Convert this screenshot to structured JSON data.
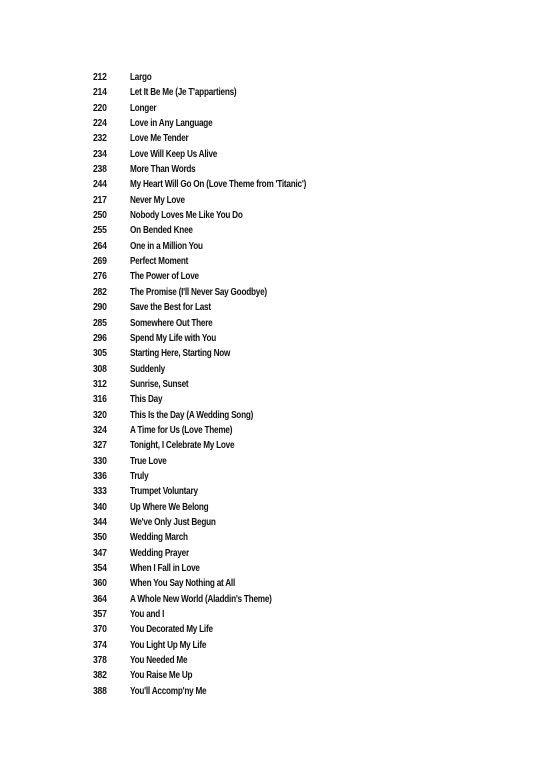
{
  "contents": [
    {
      "page": "212",
      "title": "Largo"
    },
    {
      "page": "214",
      "title": "Let It Be Me (Je T'appartiens)"
    },
    {
      "page": "220",
      "title": "Longer"
    },
    {
      "page": "224",
      "title": "Love in Any Language"
    },
    {
      "page": "232",
      "title": "Love Me Tender"
    },
    {
      "page": "234",
      "title": "Love Will Keep Us Alive"
    },
    {
      "page": "238",
      "title": "More Than Words"
    },
    {
      "page": "244",
      "title": "My Heart Will Go On (Love Theme from 'Titanic')"
    },
    {
      "page": "217",
      "title": "Never My Love"
    },
    {
      "page": "250",
      "title": "Nobody Loves Me Like You Do"
    },
    {
      "page": "255",
      "title": "On Bended Knee"
    },
    {
      "page": "264",
      "title": "One in a Million You"
    },
    {
      "page": "269",
      "title": "Perfect Moment"
    },
    {
      "page": "276",
      "title": "The Power of Love"
    },
    {
      "page": "282",
      "title": "The Promise (I'll Never Say Goodbye)"
    },
    {
      "page": "290",
      "title": "Save the Best for Last"
    },
    {
      "page": "285",
      "title": "Somewhere Out There"
    },
    {
      "page": "296",
      "title": "Spend My Life with You"
    },
    {
      "page": "305",
      "title": "Starting Here, Starting Now"
    },
    {
      "page": "308",
      "title": "Suddenly"
    },
    {
      "page": "312",
      "title": "Sunrise, Sunset"
    },
    {
      "page": "316",
      "title": "This Day"
    },
    {
      "page": "320",
      "title": "This Is the Day (A Wedding Song)"
    },
    {
      "page": "324",
      "title": "A Time for Us (Love Theme)"
    },
    {
      "page": "327",
      "title": "Tonight, I Celebrate My Love"
    },
    {
      "page": "330",
      "title": "True Love"
    },
    {
      "page": "336",
      "title": "Truly"
    },
    {
      "page": "333",
      "title": "Trumpet Voluntary"
    },
    {
      "page": "340",
      "title": "Up Where We Belong"
    },
    {
      "page": "344",
      "title": "We've Only Just Begun"
    },
    {
      "page": "350",
      "title": "Wedding March"
    },
    {
      "page": "347",
      "title": "Wedding Prayer"
    },
    {
      "page": "354",
      "title": "When I Fall in Love"
    },
    {
      "page": "360",
      "title": "When You Say Nothing at All"
    },
    {
      "page": "364",
      "title": "A Whole New World (Aladdin's Theme)"
    },
    {
      "page": "357",
      "title": "You and I"
    },
    {
      "page": "370",
      "title": "You Decorated My Life"
    },
    {
      "page": "374",
      "title": "You Light Up My Life"
    },
    {
      "page": "378",
      "title": "You Needed Me"
    },
    {
      "page": "382",
      "title": "You Raise Me Up"
    },
    {
      "page": "388",
      "title": "You'll Accomp'ny Me"
    }
  ]
}
